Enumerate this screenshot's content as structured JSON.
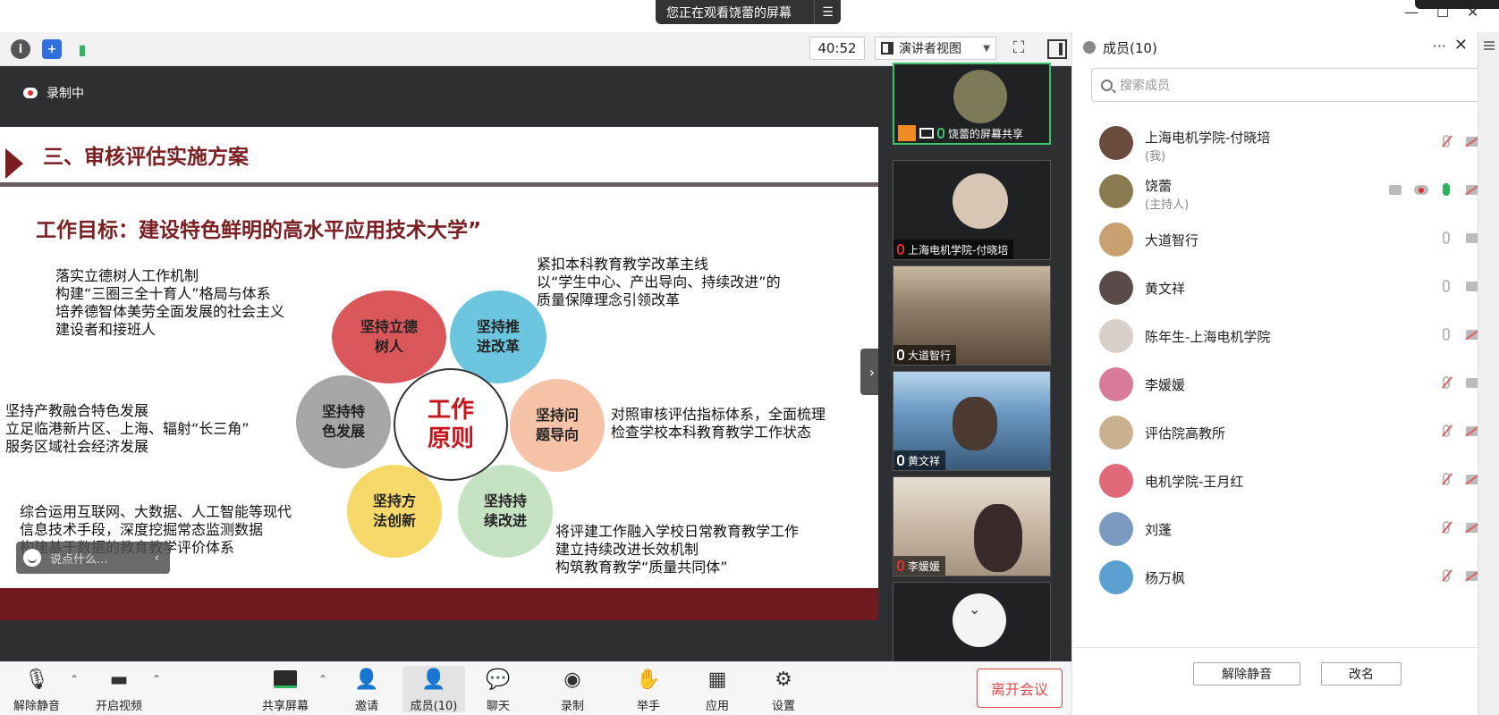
{
  "window": {
    "screen_banner": "您正在观看饶蕾的屏幕",
    "menu_icon": "menu-icon"
  },
  "toolbar": {
    "timer": "40:52",
    "view_mode": "演讲者视图",
    "icons": [
      "info-icon",
      "shield-icon",
      "signal-icon",
      "fullscreen-icon",
      "sidebar-toggle-icon"
    ]
  },
  "share": {
    "recording_label": "录制中"
  },
  "slide": {
    "title": "三、审核评估实施方案",
    "goal": "工作目标：建设特色鲜明的高水平应用技术大学”",
    "blocks": {
      "top_left": [
        "落实立德树人工作机制",
        "构建“三圈三全十育人”格局与体系",
        "培养德智体美劳全面发展的社会主义",
        "建设者和接班人"
      ],
      "top_right": [
        "紧扣本科教育教学改革主线",
        "以“学生中心、产出导向、持续改进”的",
        "质量保障理念引领改革"
      ],
      "mid_left": [
        "坚持产教融合特色发展",
        "立足临港新片区、上海、辐射“长三角”",
        "服务区域社会经济发展"
      ],
      "mid_right": [
        "对照审核评估指标体系，全面梳理",
        "检查学校本科教育教学工作状态"
      ],
      "bottom_left": [
        "综合运用互联网、大数据、人工智能等现代",
        "信息技术手段，深度挖掘常态监测数据",
        "构建基于数据的教育教学评价体系"
      ],
      "bottom_right": [
        "将评建工作融入学校日常教育教学工作",
        "建立持续改进长效机制",
        "构筑教育教学“质量共同体”"
      ]
    },
    "center": [
      "工作",
      "原则"
    ],
    "petals": [
      {
        "line1": "坚持立德",
        "line2": "树人",
        "color": "#d9575a"
      },
      {
        "line1": "坚持推",
        "line2": "进改革",
        "color": "#6dc6e0"
      },
      {
        "line1": "坚持特",
        "line2": "色发展",
        "color": "#a6a6a6"
      },
      {
        "line1": "坚持问",
        "line2": "题导向",
        "color": "#f6c3a9"
      },
      {
        "line1": "坚持方",
        "line2": "法创新",
        "color": "#f7d96a"
      },
      {
        "line1": "坚持持",
        "line2": "续改进",
        "color": "#c5e2c2"
      }
    ],
    "reaction_placeholder": "说点什么..."
  },
  "thumbs": [
    {
      "name": "饶蕾的屏幕共享"
    },
    {
      "name": "上海电机学院-付晓培"
    },
    {
      "name": "大道智行"
    },
    {
      "name": "黄文祥"
    },
    {
      "name": "李媛媛"
    }
  ],
  "controls": {
    "unmute": "解除静音",
    "video": "开启视频",
    "share": "共享屏幕",
    "invite": "邀请",
    "members": "成员(10)",
    "chat": "聊天",
    "record": "录制",
    "raise_hand": "举手",
    "apps": "应用",
    "settings": "设置",
    "leave": "离开会议"
  },
  "members_panel": {
    "title": "成员(10)",
    "more": "···",
    "search_placeholder": "搜索成员",
    "members": [
      {
        "name": "上海电机学院-付晓培",
        "role": "(我)",
        "color": "#6a4a3a"
      },
      {
        "name": "饶蕾",
        "role": "(主持人)",
        "color": "#8a7a50"
      },
      {
        "name": "大道智行",
        "role": "",
        "color": "#c9a070"
      },
      {
        "name": "黄文祥",
        "role": "",
        "color": "#5a4a4a"
      },
      {
        "name": "陈年生-上海电机学院",
        "role": "",
        "color": "#d8d0c8"
      },
      {
        "name": "李媛媛",
        "role": "",
        "color": "#d87a9a"
      },
      {
        "name": "评估院高教所",
        "role": "",
        "color": "#c8b090"
      },
      {
        "name": "电机学院-王月红",
        "role": "",
        "color": "#e06a7a"
      },
      {
        "name": "刘蓬",
        "role": "",
        "color": "#7a9ac0"
      },
      {
        "name": "杨万枫",
        "role": "",
        "color": "#5aa0d0"
      }
    ],
    "footer": {
      "unmute_all": "解除静音",
      "rename": "改名"
    }
  }
}
